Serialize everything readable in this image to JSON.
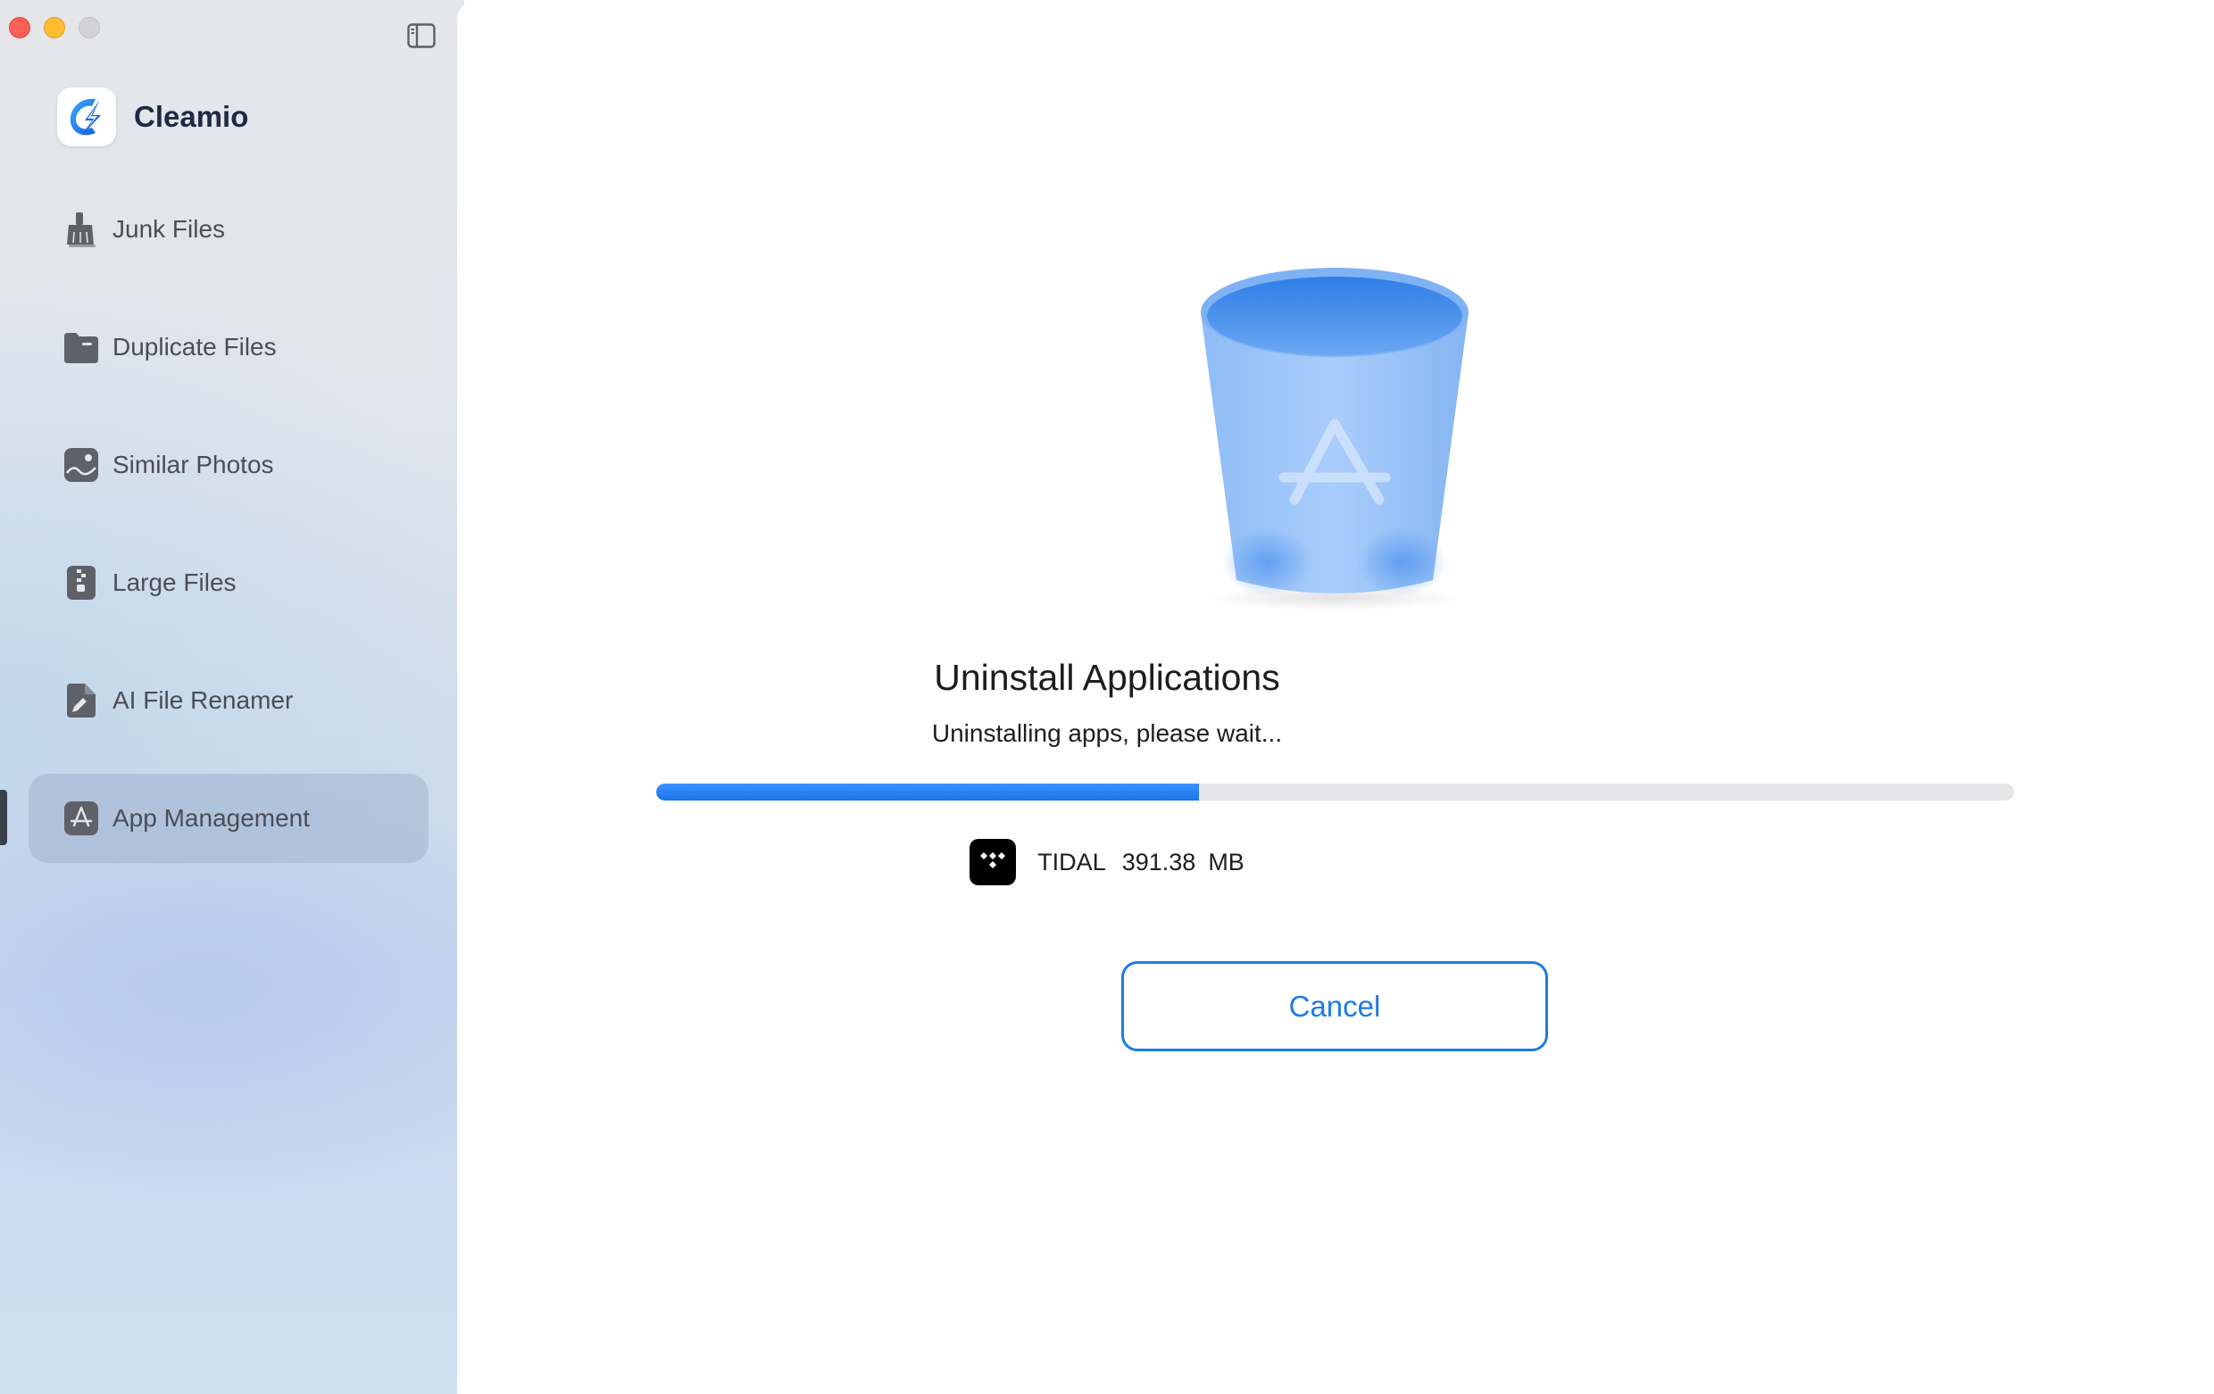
{
  "window": {
    "controls": [
      "close",
      "minimize",
      "maximize"
    ]
  },
  "sidebar": {
    "toggle_icon": "sidebar-toggle-icon",
    "brand": {
      "name": "Cleamio",
      "icon": "cleamio-logo-icon"
    },
    "items": [
      {
        "label": "Junk Files",
        "icon": "broom-icon",
        "active": false
      },
      {
        "label": "Duplicate Files",
        "icon": "folder-icon",
        "active": false
      },
      {
        "label": "Similar Photos",
        "icon": "photo-icon",
        "active": false
      },
      {
        "label": "Large Files",
        "icon": "zip-file-icon",
        "active": false
      },
      {
        "label": "AI File Renamer",
        "icon": "file-rename-icon",
        "active": false
      },
      {
        "label": "App Management",
        "icon": "app-store-icon",
        "active": true
      }
    ]
  },
  "main": {
    "illustration": "trash-can-app-icon",
    "title": "Uninstall Applications",
    "subtitle": "Uninstalling apps, please wait...",
    "progress": 0.4,
    "current_app": {
      "name": "TIDAL",
      "size": "391.38",
      "unit": "MB",
      "icon": "tidal-icon"
    },
    "cancel_label": "Cancel"
  },
  "colors": {
    "accent": "#1f7ae8",
    "progress_track": "#e5e5e7",
    "active_nav": "#a0b2cd",
    "close": "#fe5f57",
    "minimize": "#febc2e",
    "maximize": "#d3d3d6"
  }
}
